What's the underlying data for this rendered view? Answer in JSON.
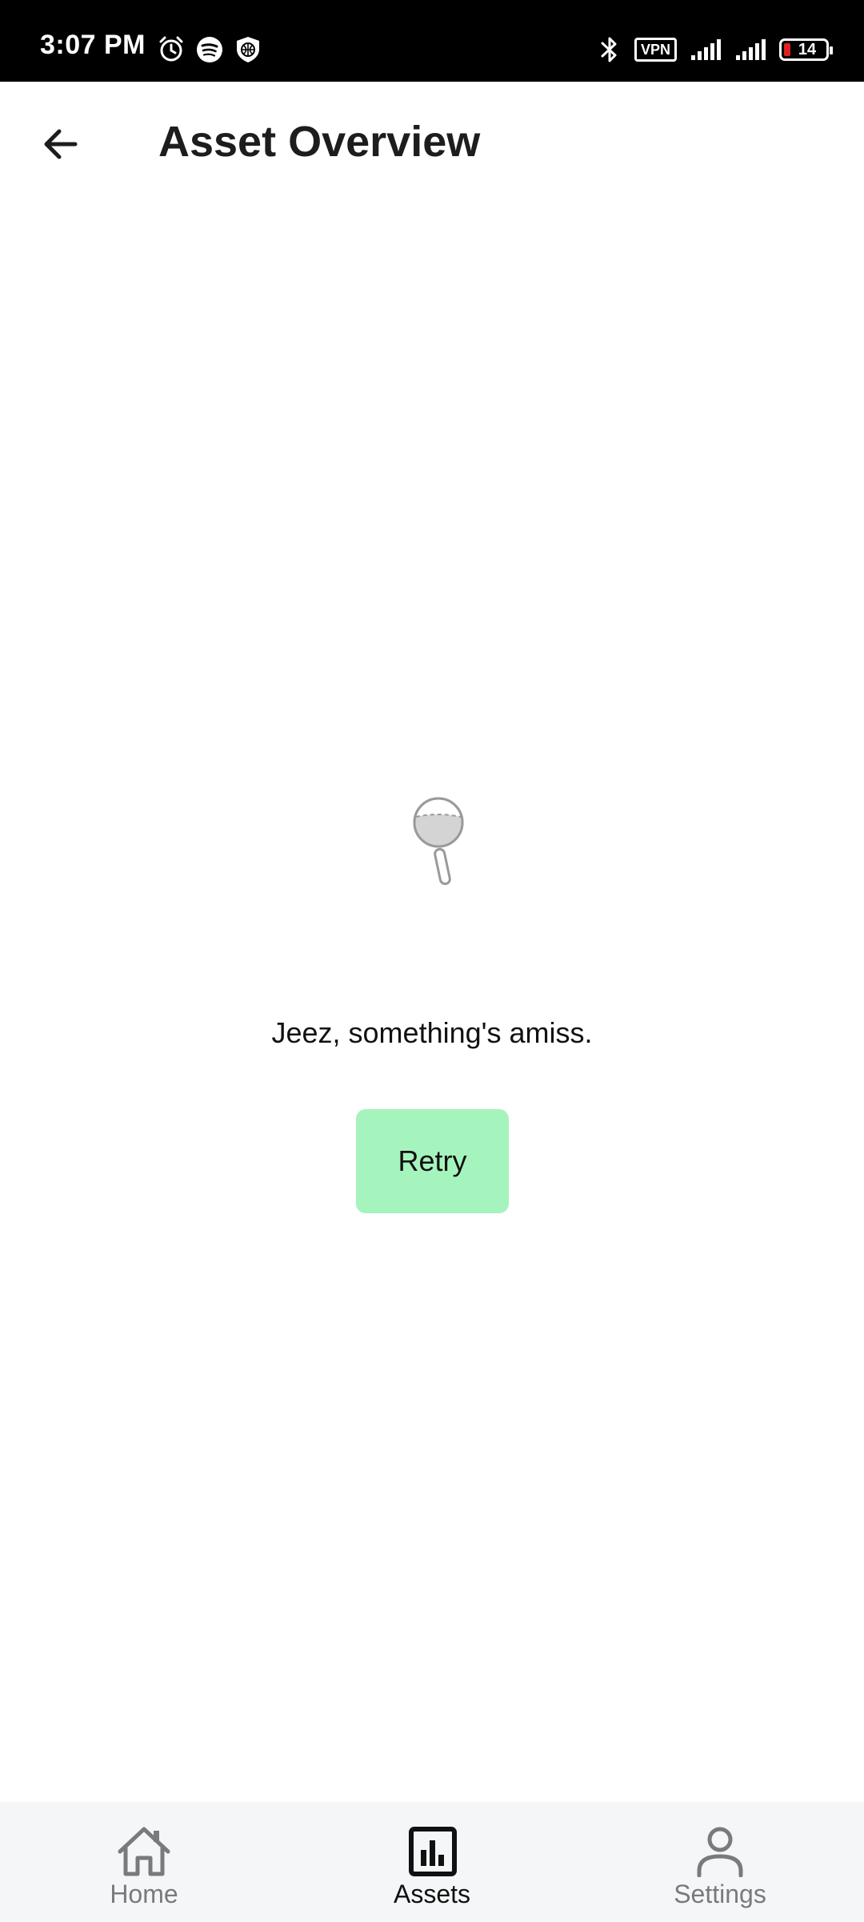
{
  "status_bar": {
    "time": "3:07 PM",
    "left_icons": [
      "alarm-icon",
      "spotify-icon",
      "vpn-shield-icon"
    ],
    "right_icons": [
      "bluetooth-icon",
      "vpn-badge",
      "signal-icon",
      "signal-icon",
      "battery-icon"
    ],
    "vpn_label": "VPN",
    "battery_level": "14",
    "battery_color": "#e02020"
  },
  "app_bar": {
    "back_icon": "arrow-left-icon",
    "title": "Asset Overview"
  },
  "error_state": {
    "illustration_icon": "magnifying-glass-icon",
    "message": "Jeez, something's amiss.",
    "retry_label": "Retry",
    "retry_color": "#a6f4bd"
  },
  "bottom_nav": {
    "items": [
      {
        "label": "Home",
        "icon": "home-icon",
        "active": false
      },
      {
        "label": "Assets",
        "icon": "bar-chart-icon",
        "active": true
      },
      {
        "label": "Settings",
        "icon": "person-icon",
        "active": false
      }
    ],
    "background": "#f5f6f8"
  }
}
